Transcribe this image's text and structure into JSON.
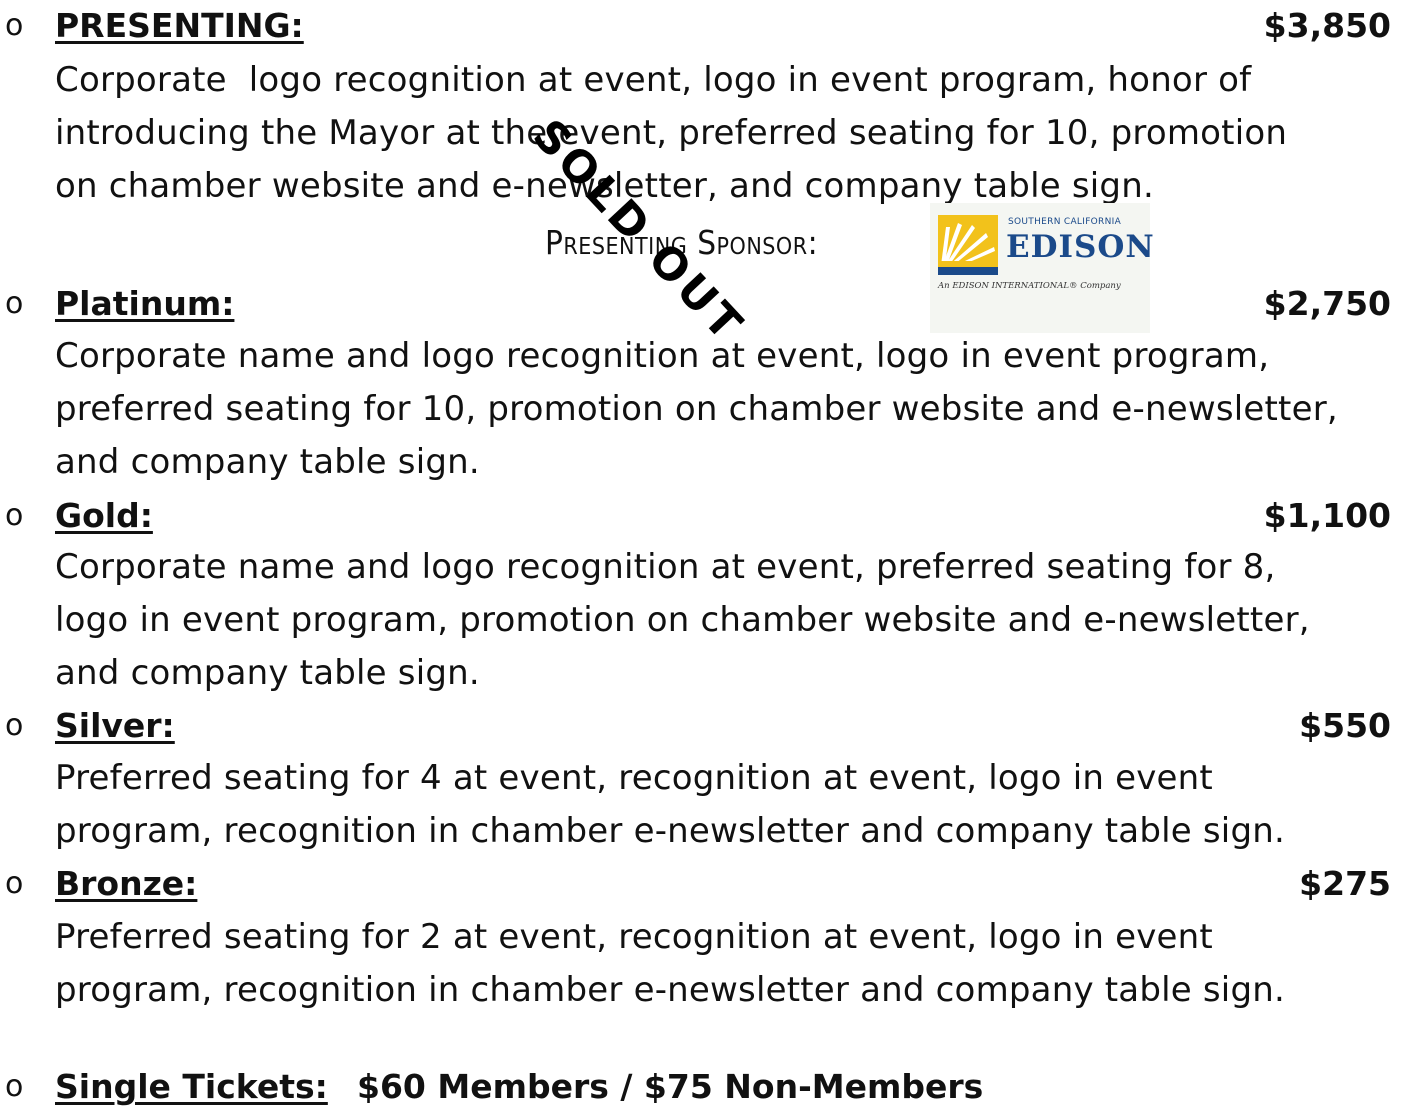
{
  "bullet_symbol": "o",
  "tiers": [
    {
      "name": "PRESENTING:",
      "price": "$3,850",
      "description": "Corporate  logo recognition at event, logo in event program, honor of\nintroducing the Mayor at the event, preferred seating for 10, promotion\non chamber website and e-newsletter, and company table sign."
    },
    {
      "name": "Platinum:",
      "price": "$2,750",
      "description": "Corporate name and logo recognition at event, logo in event program,\npreferred seating for 10, promotion on chamber website and e-newsletter,\nand company table sign."
    },
    {
      "name": "Gold:",
      "price": "$1,100",
      "description": "Corporate name and logo recognition at event, preferred seating for 8,\nlogo in event program, promotion on chamber website and e-newsletter,\nand company table sign."
    },
    {
      "name": "Silver:",
      "price": "$550",
      "description": "Preferred seating for 4 at event, recognition at event, logo in event\nprogram, recognition in chamber e-newsletter and company table sign."
    },
    {
      "name": "Bronze:",
      "price": "$275",
      "description": "Preferred seating for 2 at event, recognition at event, logo in event\nprogram, recognition in chamber e-newsletter and company table sign."
    }
  ],
  "presenting_sponsor_label": "Presenting Sponsor:",
  "sponsor_logo": {
    "small_text": "SOUTHERN CALIFORNIA",
    "name": "EDISON",
    "tagline": "An EDISON INTERNATIONAL® Company",
    "color": "#1b4a8a",
    "accent": "#f2c21b"
  },
  "stamp_text": "SOLD OUT",
  "single_tickets": {
    "label": "Single Tickets:",
    "price": "$60 Members / $75 Non-Members"
  }
}
